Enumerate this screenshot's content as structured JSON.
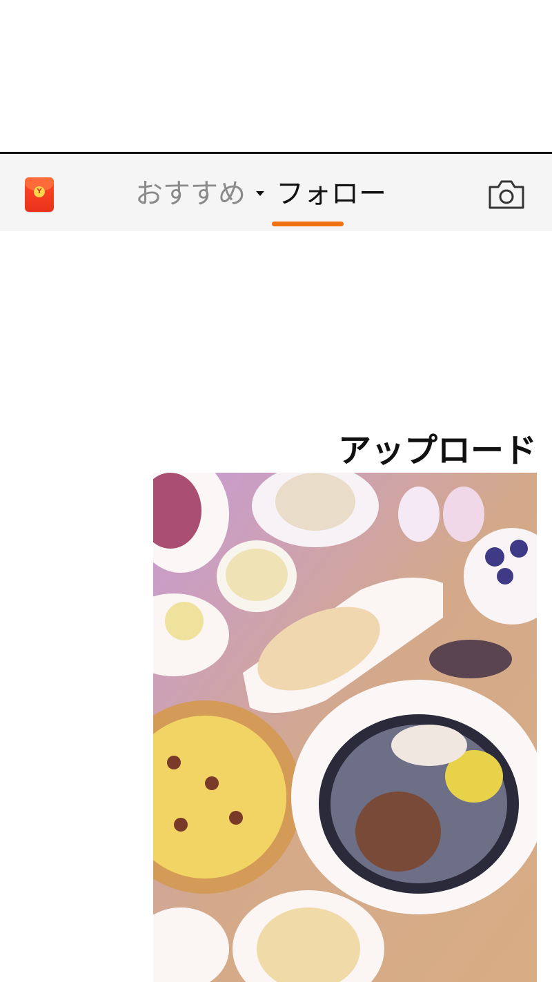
{
  "header": {
    "redpacket_symbol": "Y",
    "tabs": [
      {
        "label": "おすすめ",
        "active": false
      },
      {
        "label": "フォロー",
        "active": true
      }
    ],
    "accent_color": "#f07214"
  },
  "main": {
    "upload_label": "アップロード"
  },
  "icons": [
    "red-envelope-icon",
    "caret-down-icon",
    "camera-icon"
  ]
}
